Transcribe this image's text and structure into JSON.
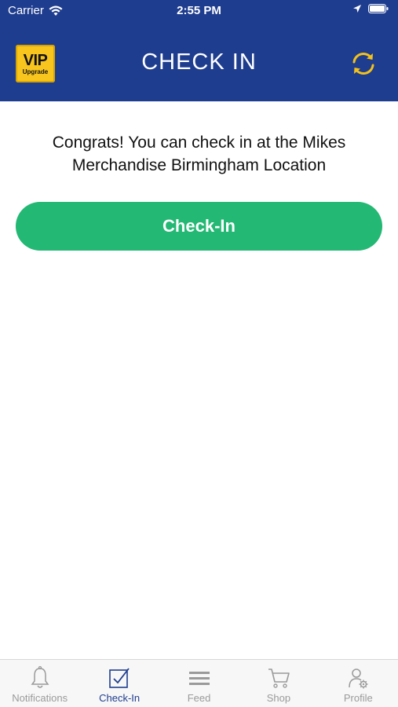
{
  "status_bar": {
    "carrier": "Carrier",
    "time": "2:55 PM"
  },
  "header": {
    "title": "CHECK IN",
    "vip_badge": {
      "title": "VIP",
      "subtitle": "Upgrade"
    },
    "refresh_icon": "refresh-icon"
  },
  "content": {
    "message": "Congrats! You can check in at the Mikes Merchandise Birmingham Location",
    "checkin_button_label": "Check-In"
  },
  "tab_bar": {
    "items": [
      {
        "label": "Notifications",
        "icon": "bell-icon",
        "active": false
      },
      {
        "label": "Check-In",
        "icon": "checkbox-icon",
        "active": true
      },
      {
        "label": "Feed",
        "icon": "list-icon",
        "active": false
      },
      {
        "label": "Shop",
        "icon": "cart-icon",
        "active": false
      },
      {
        "label": "Profile",
        "icon": "profile-gear-icon",
        "active": false
      }
    ]
  },
  "colors": {
    "header_blue": "#1f3d8f",
    "button_green": "#23b873",
    "vip_yellow": "#f7c51e",
    "refresh_gold": "#f3c21a",
    "tab_active": "#1f3d8f",
    "tab_inactive": "#9a9a9a"
  }
}
